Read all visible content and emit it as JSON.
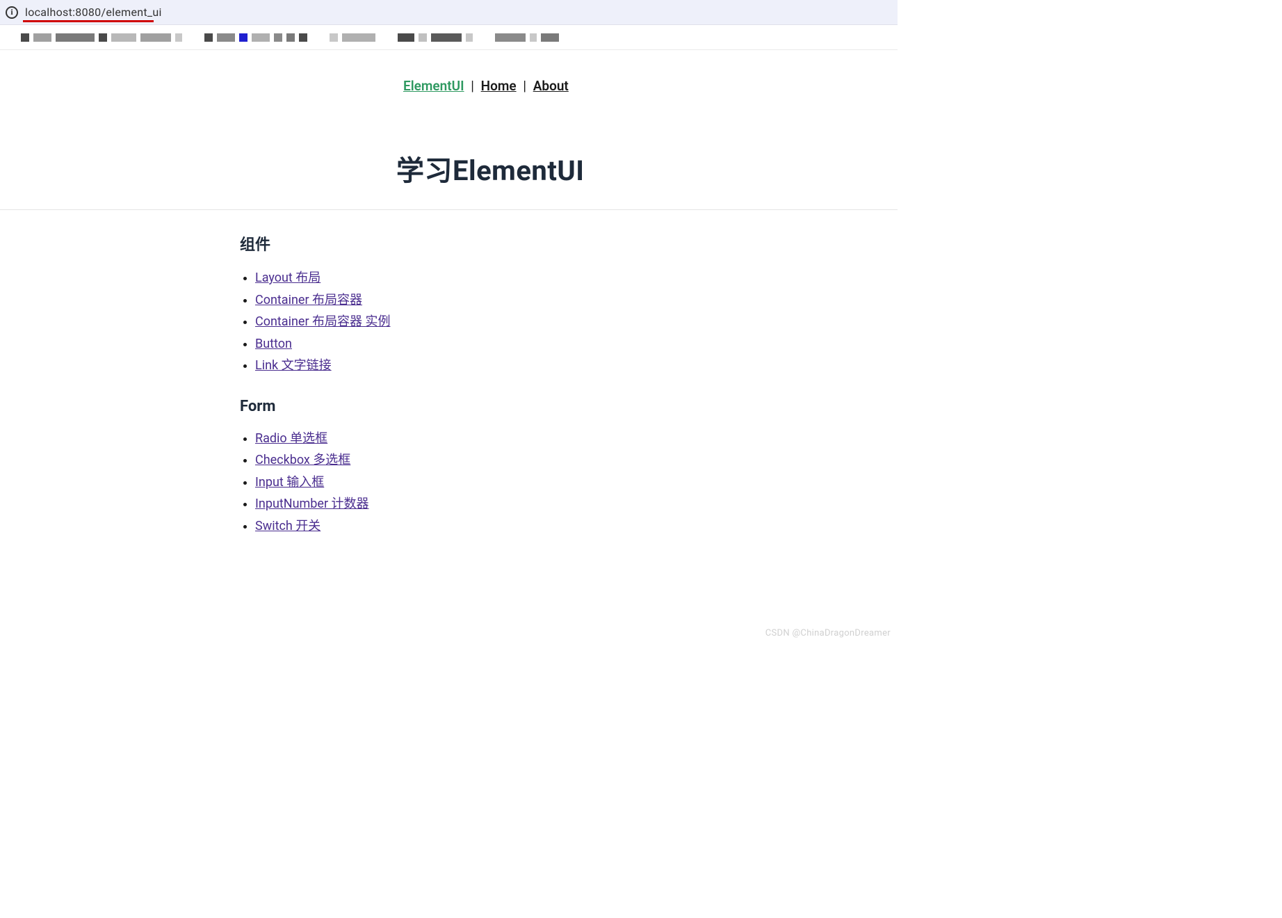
{
  "browser": {
    "url": "localhost:8080/element_ui"
  },
  "nav": {
    "links": [
      {
        "label": "ElementUI",
        "active": true
      },
      {
        "label": "Home",
        "active": false
      },
      {
        "label": "About",
        "active": false
      }
    ],
    "separator": "|"
  },
  "page": {
    "title": "学习ElementUI"
  },
  "sections": [
    {
      "heading": "组件",
      "items": [
        "Layout 布局",
        "Container 布局容器",
        "Container 布局容器 实例",
        "Button",
        "Link 文字链接"
      ]
    },
    {
      "heading": "Form",
      "items": [
        "Radio 单选框",
        "Checkbox 多选框",
        "Input 输入框",
        "InputNumber 计数器",
        "Switch 开关"
      ]
    }
  ],
  "watermark": "CSDN @ChinaDragonDreamer",
  "tab_strip_blocks": [
    12,
    26,
    56,
    12,
    36,
    44,
    10,
    12,
    26,
    12,
    26,
    12,
    12,
    12,
    12,
    48,
    24,
    12,
    44,
    10,
    44,
    10,
    26
  ],
  "tab_strip_colors": [
    "#4a4a4a",
    "#a0a0a0",
    "#7a7a7a",
    "#4a4a4a",
    "#b8b8b8",
    "#a0a0a0",
    "#c8c8c8",
    "#4a4a4a",
    "#8a8a8a",
    "#2020d0",
    "#b0b0b0",
    "#8a8a8a",
    "#7a7a7a",
    "#4a4a4a",
    "#c8c8c8",
    "#b0b0b0",
    "#4a4a4a",
    "#c0c0c0",
    "#5a5a5a",
    "#c8c8c8",
    "#8a8a8a",
    "#c8c8c8",
    "#7a7a7a"
  ]
}
